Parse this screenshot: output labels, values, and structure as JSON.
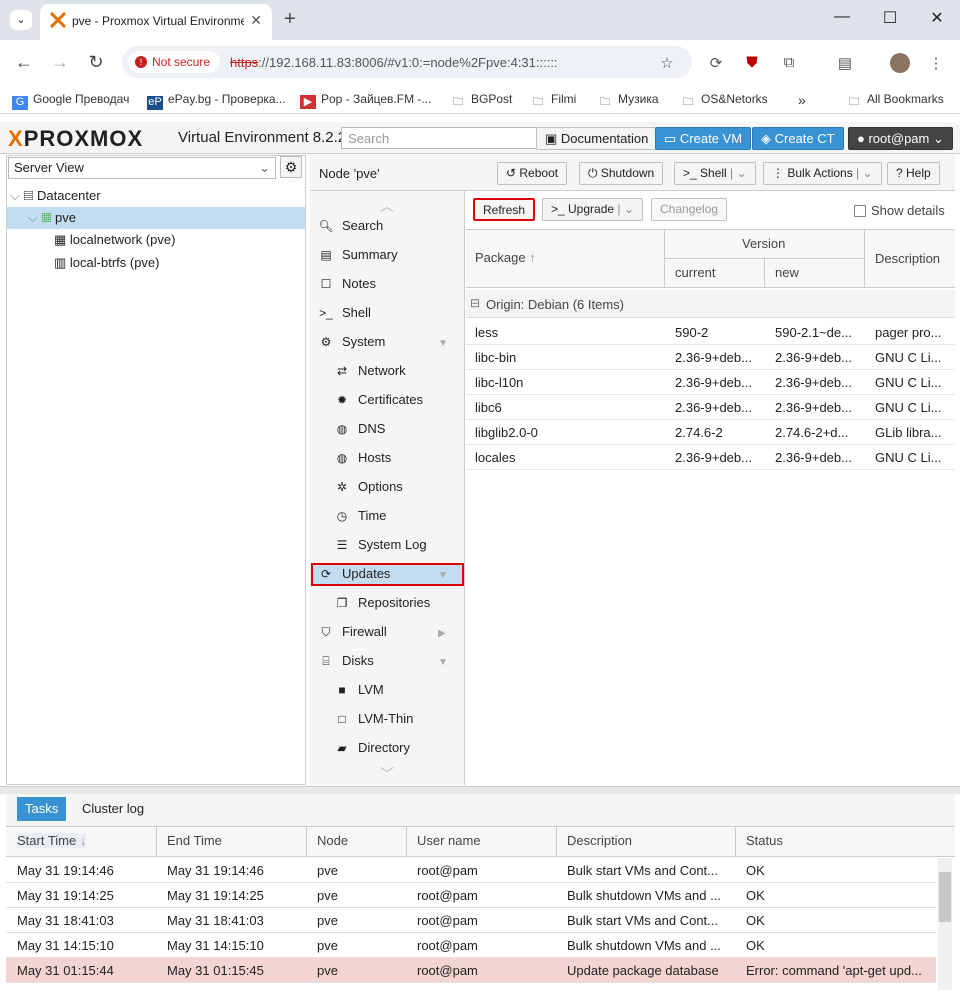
{
  "browser": {
    "tab_title": "pve - Proxmox Virtual Environment",
    "not_secure": "Not secure",
    "url_scheme": "https",
    "url_rest": "://192.168.11.83:8006/#v1:0:=node%2Fpve:4:31::::::",
    "bookmarks": [
      "Google Преводач",
      "ePay.bg - Проверка...",
      "Pop - Зайцев.FM -...",
      "BGPost",
      "Filmi",
      "Музика",
      "OS&Netorks"
    ],
    "all_bookmarks": "All Bookmarks"
  },
  "header": {
    "logo_x": "X",
    "logo_text": "PROXMOX",
    "version": "Virtual Environment 8.2.2",
    "search_placeholder": "Search",
    "documentation": "Documentation",
    "create_vm": "Create VM",
    "create_ct": "Create CT",
    "user": "root@pam"
  },
  "tree": {
    "view": "Server View",
    "datacenter": "Datacenter",
    "node": "pve",
    "items": [
      "localnetwork (pve)",
      "local-btrfs (pve)"
    ]
  },
  "node": {
    "title": "Node 'pve'",
    "reboot": "Reboot",
    "shutdown": "Shutdown",
    "shell": "Shell",
    "bulk": "Bulk Actions",
    "help": "Help"
  },
  "menu": [
    {
      "label": "Search",
      "icon": "search-icon",
      "sub": false
    },
    {
      "label": "Summary",
      "icon": "book-icon",
      "sub": false
    },
    {
      "label": "Notes",
      "icon": "note-icon",
      "sub": false
    },
    {
      "label": "Shell",
      "icon": "terminal-icon",
      "sub": false
    },
    {
      "label": "System",
      "icon": "cogs-icon",
      "sub": false
    },
    {
      "label": "Network",
      "icon": "exchange-icon",
      "sub": true
    },
    {
      "label": "Certificates",
      "icon": "certificate-icon",
      "sub": true
    },
    {
      "label": "DNS",
      "icon": "globe-icon",
      "sub": true
    },
    {
      "label": "Hosts",
      "icon": "globe-icon",
      "sub": true
    },
    {
      "label": "Options",
      "icon": "gear-icon",
      "sub": true
    },
    {
      "label": "Time",
      "icon": "clock-icon",
      "sub": true
    },
    {
      "label": "System Log",
      "icon": "list-icon",
      "sub": true
    },
    {
      "label": "Updates",
      "icon": "refresh-icon",
      "sub": false
    },
    {
      "label": "Repositories",
      "icon": "files-icon",
      "sub": true
    },
    {
      "label": "Firewall",
      "icon": "shield-icon",
      "sub": false
    },
    {
      "label": "Disks",
      "icon": "hdd-icon",
      "sub": false
    },
    {
      "label": "LVM",
      "icon": "square-icon",
      "sub": true
    },
    {
      "label": "LVM-Thin",
      "icon": "square-outline-icon",
      "sub": true
    },
    {
      "label": "Directory",
      "icon": "folder-icon",
      "sub": true
    }
  ],
  "updates": {
    "refresh": "Refresh",
    "upgrade": "Upgrade",
    "changelog": "Changelog",
    "show_details": "Show details",
    "col_package": "Package",
    "col_version": "Version",
    "col_current": "current",
    "col_new": "new",
    "col_description": "Description",
    "group": "Origin: Debian (6 Items)",
    "rows": [
      {
        "package": "less",
        "current": "590-2",
        "new": "590-2.1~de...",
        "desc": "pager pro..."
      },
      {
        "package": "libc-bin",
        "current": "2.36-9+deb...",
        "new": "2.36-9+deb...",
        "desc": "GNU C Li..."
      },
      {
        "package": "libc-l10n",
        "current": "2.36-9+deb...",
        "new": "2.36-9+deb...",
        "desc": "GNU C Li..."
      },
      {
        "package": "libc6",
        "current": "2.36-9+deb...",
        "new": "2.36-9+deb...",
        "desc": "GNU C Li..."
      },
      {
        "package": "libglib2.0-0",
        "current": "2.74.6-2",
        "new": "2.74.6-2+d...",
        "desc": "GLib libra..."
      },
      {
        "package": "locales",
        "current": "2.36-9+deb...",
        "new": "2.36-9+deb...",
        "desc": "GNU C Li..."
      }
    ]
  },
  "tasks": {
    "tab_tasks": "Tasks",
    "tab_cluster": "Cluster log",
    "cols": [
      "Start Time",
      "End Time",
      "Node",
      "User name",
      "Description",
      "Status"
    ],
    "rows": [
      {
        "start": "May 31 19:14:46",
        "end": "May 31 19:14:46",
        "node": "pve",
        "user": "root@pam",
        "desc": "Bulk start VMs and Cont...",
        "status": "OK",
        "error": false
      },
      {
        "start": "May 31 19:14:25",
        "end": "May 31 19:14:25",
        "node": "pve",
        "user": "root@pam",
        "desc": "Bulk shutdown VMs and ...",
        "status": "OK",
        "error": false
      },
      {
        "start": "May 31 18:41:03",
        "end": "May 31 18:41:03",
        "node": "pve",
        "user": "root@pam",
        "desc": "Bulk start VMs and Cont...",
        "status": "OK",
        "error": false
      },
      {
        "start": "May 31 14:15:10",
        "end": "May 31 14:15:10",
        "node": "pve",
        "user": "root@pam",
        "desc": "Bulk shutdown VMs and ...",
        "status": "OK",
        "error": false
      },
      {
        "start": "May 31 01:15:44",
        "end": "May 31 01:15:45",
        "node": "pve",
        "user": "root@pam",
        "desc": "Update package database",
        "status": "Error: command 'apt-get upd...",
        "error": true
      }
    ]
  },
  "colors": {
    "accent": "#3892d4",
    "selection": "#c2ddf2",
    "error_row": "#f4d3d3",
    "highlight_box": "#dd0000",
    "brand_orange": "#e57000"
  }
}
